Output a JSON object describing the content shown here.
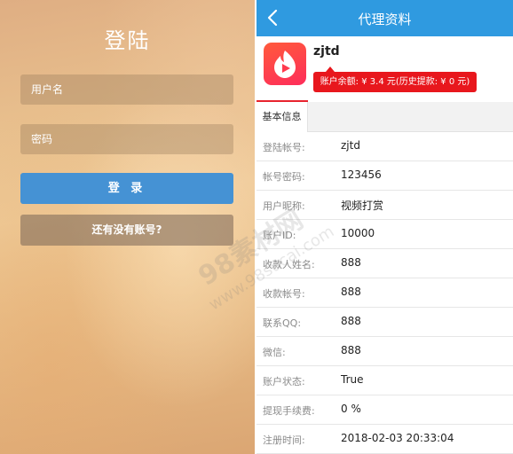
{
  "login": {
    "title": "登陆",
    "username_placeholder": "用户名",
    "password_placeholder": "密码",
    "login_button": "登 录",
    "register_button": "还有没有账号?"
  },
  "profile": {
    "header_title": "代理资料",
    "back_icon": "chevron-left-icon",
    "username": "zjtd",
    "balance_text": "账户余额: ¥ 3.4 元(历史提款: ¥ 0 元)",
    "tab_label": "基本信息",
    "rows": [
      {
        "label": "登陆帐号:",
        "value": "zjtd"
      },
      {
        "label": "帐号密码:",
        "value": "123456"
      },
      {
        "label": "用户昵称:",
        "value": "视频打赏"
      },
      {
        "label": "账户ID:",
        "value": "10000"
      },
      {
        "label": "收款人姓名:",
        "value": "888"
      },
      {
        "label": "收款帐号:",
        "value": "888"
      },
      {
        "label": "联系QQ:",
        "value": "888"
      },
      {
        "label": "微信:",
        "value": "888"
      },
      {
        "label": "账户状态:",
        "value": "True"
      },
      {
        "label": "提现手续费:",
        "value": "0 %"
      },
      {
        "label": "注册时间:",
        "value": "2018-02-03 20:33:04"
      }
    ]
  },
  "watermark": {
    "line1": "98素材网",
    "line2": "www.98sucai.com"
  },
  "colors": {
    "topbar": "#2f9ae0",
    "login_button": "#4592d4",
    "balance_badge": "#e8171d"
  }
}
